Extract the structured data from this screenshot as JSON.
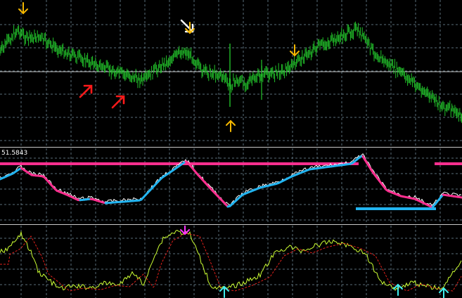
{
  "colors": {
    "background": "#000000",
    "grid": "#5a6e7a",
    "price": "#22c02a",
    "signal_up_down": "#f5b800",
    "signal_white": "#ffffff",
    "signal_red": "#ff1a1a",
    "level_line": "#c8c8c8",
    "ind1_pink": "#ff2f8f",
    "ind1_blue": "#22b4f0",
    "ind1_white": "#ffffff",
    "ind2_yellow": "#ccff33",
    "ind2_red_dash": "#e0201b",
    "arrow_cyan": "#40f0f0",
    "arrow_magenta": "#ff33ff"
  },
  "indicator1": {
    "value_label": "51.5843"
  },
  "icons": {
    "down_arrow": "arrow-down-icon",
    "up_arrow": "arrow-up-icon",
    "diag_up_arrow": "arrow-up-right-icon",
    "diag_down_arrow": "arrow-down-right-icon"
  }
}
